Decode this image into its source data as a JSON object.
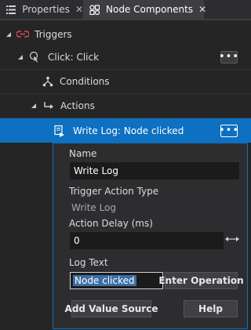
{
  "tabs": [
    {
      "label": "Properties",
      "close": "✕",
      "icon": "list-icon",
      "active": false
    },
    {
      "label": "Node Components",
      "close": "✕",
      "icon": "component-icon",
      "active": true
    }
  ],
  "tree": {
    "triggers": "Triggers",
    "click_trigger": "Click: Click",
    "conditions": "Conditions",
    "actions": "Actions",
    "write_log": "Write Log: Node clicked",
    "more_label": "•••"
  },
  "panel": {
    "name_label": "Name",
    "name_value": "Write Log",
    "type_label": "Trigger Action Type",
    "type_value": "Write Log",
    "delay_label": "Action Delay (ms)",
    "delay_value": "0",
    "log_label": "Log Text",
    "log_value": "Node clicked",
    "enter_operation": "Enter Operation",
    "add_value_source": "Add Value Source",
    "help": "Help"
  },
  "colors": {
    "background": "#252526",
    "selection": "#0e70c0",
    "trigger_icon": "#e0474c"
  }
}
